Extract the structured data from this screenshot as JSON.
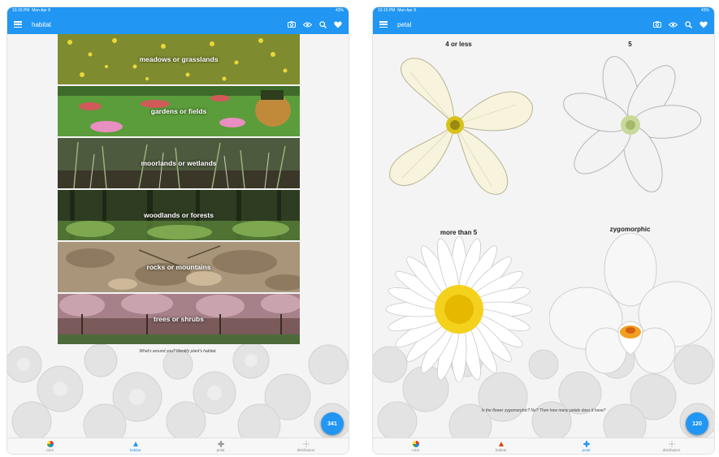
{
  "left": {
    "status": {
      "time": "10:15 PM",
      "date": "Mon Apr 8",
      "battery": "43%"
    },
    "appbar_title": "habitat",
    "habitats": [
      {
        "label": "meadows or grasslands"
      },
      {
        "label": "gardens or fields"
      },
      {
        "label": "moorlands or wetlands"
      },
      {
        "label": "woodlands or forests"
      },
      {
        "label": "rocks or mountains"
      },
      {
        "label": "trees or shrubs"
      }
    ],
    "hint": "What's around you? Identify plant's habitat.",
    "fab_count": "341",
    "nav": [
      {
        "label": "color",
        "icon": "color-wheel-icon"
      },
      {
        "label": "habitat",
        "icon": "habitat-icon"
      },
      {
        "label": "petal",
        "icon": "petal-icon"
      },
      {
        "label": "distribution",
        "icon": "distribution-icon"
      }
    ]
  },
  "right": {
    "status": {
      "time": "10:15 PM",
      "date": "Mon Apr 8",
      "battery": "43%"
    },
    "appbar_title": "petal",
    "petals": [
      {
        "label": "4 or less"
      },
      {
        "label": "5"
      },
      {
        "label": "more than 5"
      },
      {
        "label": "zygomorphic"
      }
    ],
    "hint": "Is the flower zygomorphic? No? Then how many petals does it have?",
    "fab_count": "120",
    "nav": [
      {
        "label": "color",
        "icon": "color-wheel-icon"
      },
      {
        "label": "habitat",
        "icon": "habitat-icon"
      },
      {
        "label": "petal",
        "icon": "petal-icon"
      },
      {
        "label": "distribution",
        "icon": "distribution-icon"
      }
    ]
  },
  "colors": {
    "primary": "#2196f3",
    "nav_active": "#2196f3"
  }
}
